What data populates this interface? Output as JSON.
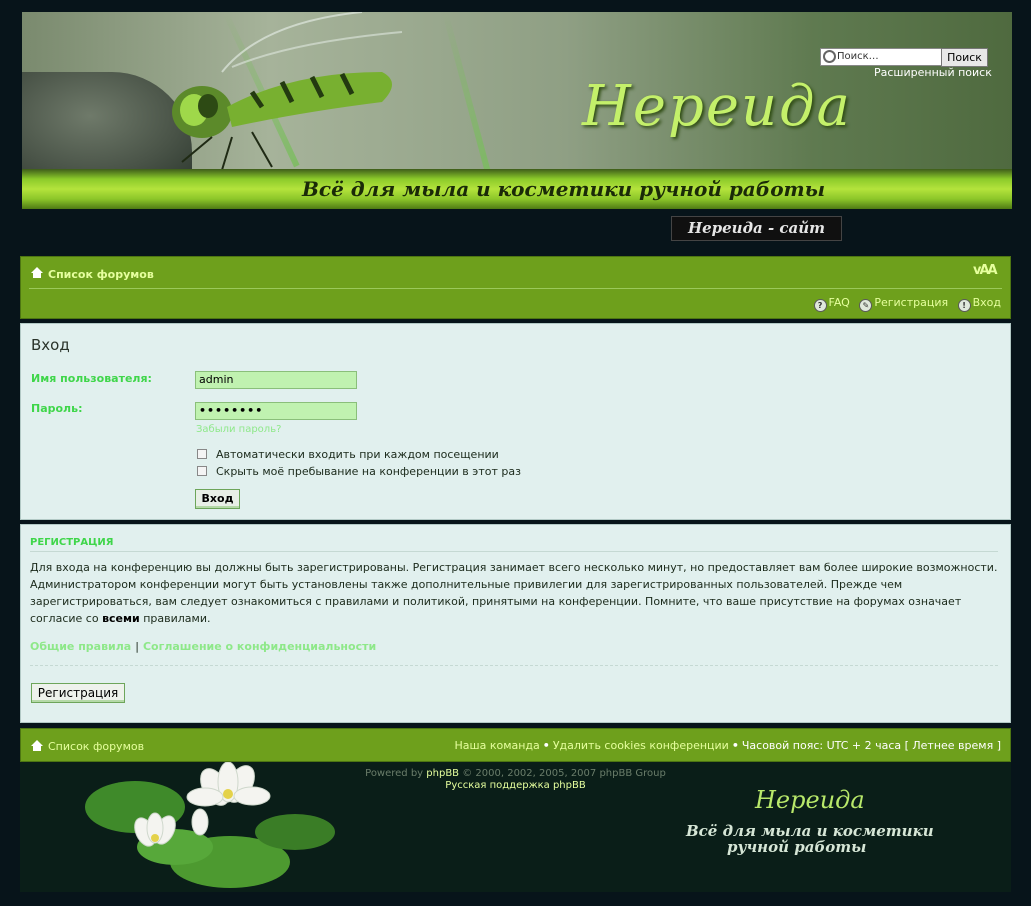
{
  "header": {
    "title": "Нереида",
    "subtitle": "Всё для мыла и косметики ручной работы",
    "search_placeholder": "Поиск…",
    "search_button": "Поиск",
    "advanced_search": "Расширенный поиск",
    "site_link": "Нереида - сайт"
  },
  "navbar": {
    "forum_list": "Список форумов",
    "font_size_icon": "vAA",
    "faq": "FAQ",
    "register": "Регистрация",
    "login": "Вход"
  },
  "login": {
    "title": "Вход",
    "username_label": "Имя пользователя:",
    "username_value": "admin",
    "password_label": "Пароль:",
    "password_value": "••••••••",
    "forgot_password": "Забыли пароль?",
    "autologin_label": "Автоматически входить при каждом посещении",
    "hide_label": "Скрыть моё пребывание на конференции в этот раз",
    "login_button": "Вход"
  },
  "registration": {
    "heading": "РЕГИСТРАЦИЯ",
    "text_before": "Для входа на конференцию вы должны быть зарегистрированы. Регистрация занимает всего несколько минут, но предоставляет вам более широкие возможности. Администратором конференции могут быть установлены также дополнительные привилегии для зарегистрированных пользователей. Прежде чем зарегистрироваться, вам следует ознакомиться с правилами и политикой, принятыми на конференции. Помните, что ваше присутствие на форумах означает согласие со ",
    "text_bold": "всеми",
    "text_after": " правилами.",
    "rules_link": "Общие правила",
    "separator": "|",
    "privacy_link": "Соглашение о конфиденциальности",
    "register_button": "Регистрация"
  },
  "footer": {
    "forum_list": "Список форумов",
    "team": "Наша команда",
    "bullet": "•",
    "delete_cookies": "Удалить cookies конференции",
    "timezone": "Часовой пояс: UTC + 2 часа [ Летнее время ]",
    "powered_prefix": "Powered by ",
    "powered_name": "phpBB",
    "powered_suffix": " © 2000, 2002, 2005, 2007 phpBB Group",
    "ru_support": "Русская поддержка phpBB",
    "logo": "Нереида",
    "slogan_line1": "Всё для мыла и косметики",
    "slogan_line2": "ручной работы"
  },
  "colors": {
    "accent_green": "#6ea01c",
    "label_green": "#3fd64a",
    "panel_bg": "#e1f0ee",
    "page_bg": "#07141a"
  }
}
